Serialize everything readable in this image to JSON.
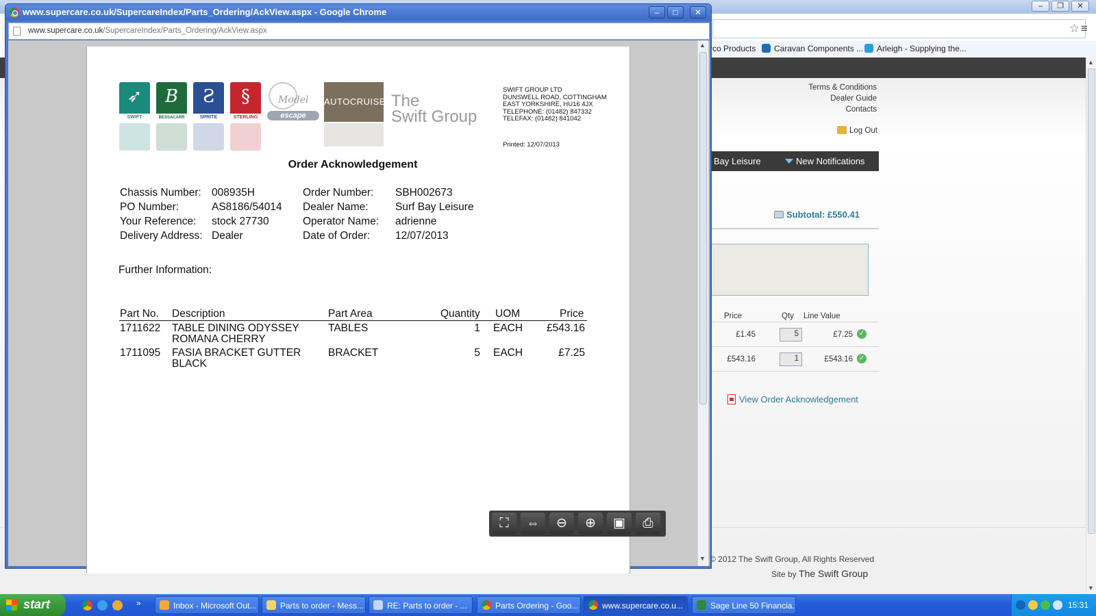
{
  "background_browser": {
    "bookmarks": [
      "rco Products",
      "Caravan Components ...",
      "Arleigh - Supplying the..."
    ],
    "top_links": [
      "Terms & Conditions",
      "Dealer Guide",
      "Contacts"
    ],
    "logout": "Log Out",
    "nav": {
      "dealer": "Bay Leisure",
      "notifications": "New Notifications"
    },
    "subtotal": "Subtotal: £550.41",
    "cart": {
      "headers": {
        "price": "Price",
        "qty": "Qty",
        "line_value": "Line Value"
      },
      "rows": [
        {
          "price": "£1.45",
          "qty": "5",
          "line_value": "£7.25"
        },
        {
          "price": "£543.16",
          "qty": "1",
          "line_value": "£543.16"
        }
      ]
    },
    "view_ack_link": "View Order Acknowledgement",
    "copyright": "© 2012 The Swift Group, All Rights Reserved",
    "site_by_label": "Site by",
    "site_by_name": "The Swift Group"
  },
  "popup": {
    "title": "www.supercare.co.uk/SupercareIndex/Parts_Ordering/AckView.aspx - Google Chrome",
    "url_host": "www.supercare.co.uk",
    "url_path": "/SupercareIndex/Parts_Ordering/AckView.aspx"
  },
  "document": {
    "brands": {
      "swift": "SWIFT",
      "bessacarr": "BESSACARR",
      "sprite": "SPRITE",
      "sterling": "STERLING",
      "model": "Model",
      "escape": "escape",
      "autocruise": "AUTOCRUISE",
      "group_line1": "The",
      "group_line2": "Swift Group"
    },
    "company": {
      "name": "SWIFT GROUP LTD",
      "address1": "DUNSWELL ROAD, COTTINGHAM",
      "address2": "EAST YORKSHIRE, HU16 4JX",
      "telephone": "TELEPHONE: (01482) 847332",
      "telefax": "TELEFAX: (01482) 841042"
    },
    "printed": "Printed: 12/07/2013",
    "title": "Order Acknowledgement",
    "fields": {
      "chassis_label": "Chassis Number:",
      "chassis_value": "008935H",
      "po_label": "PO Number:",
      "po_value": "AS8186/54014",
      "ref_label": "Your Reference:",
      "ref_value": "stock 27730",
      "delivery_label": "Delivery Address:",
      "delivery_value": "Dealer",
      "order_label": "Order Number:",
      "order_value": "SBH002673",
      "dealer_label": "Dealer Name:",
      "dealer_value": "Surf Bay Leisure",
      "operator_label": "Operator Name:",
      "operator_value": "adrienne",
      "date_label": "Date of Order:",
      "date_value": "12/07/2013"
    },
    "further_info": "Further Information:",
    "table": {
      "headers": {
        "part_no": "Part No.",
        "description": "Description",
        "part_area": "Part Area",
        "quantity": "Quantity",
        "uom": "UOM",
        "price": "Price"
      },
      "rows": [
        {
          "part_no": "1711622",
          "desc1": "TABLE DINING ODYSSEY",
          "desc2": "ROMANA CHERRY",
          "part_area": "TABLES",
          "quantity": "1",
          "uom": "EACH",
          "price": "£543.16"
        },
        {
          "part_no": "1711095",
          "desc1": "FASIA BRACKET GUTTER",
          "desc2": "BLACK",
          "part_area": "BRACKET",
          "quantity": "5",
          "uom": "EACH",
          "price": "£7.25"
        }
      ]
    }
  },
  "taskbar": {
    "start": "start",
    "tasks": [
      "Inbox - Microsoft Out...",
      "Parts to order - Mess...",
      "RE: Parts to order - ...",
      "Parts Ordering - Goo...",
      "www.supercare.co.u...",
      "Sage Line 50 Financia..."
    ],
    "clock": "15:31"
  }
}
